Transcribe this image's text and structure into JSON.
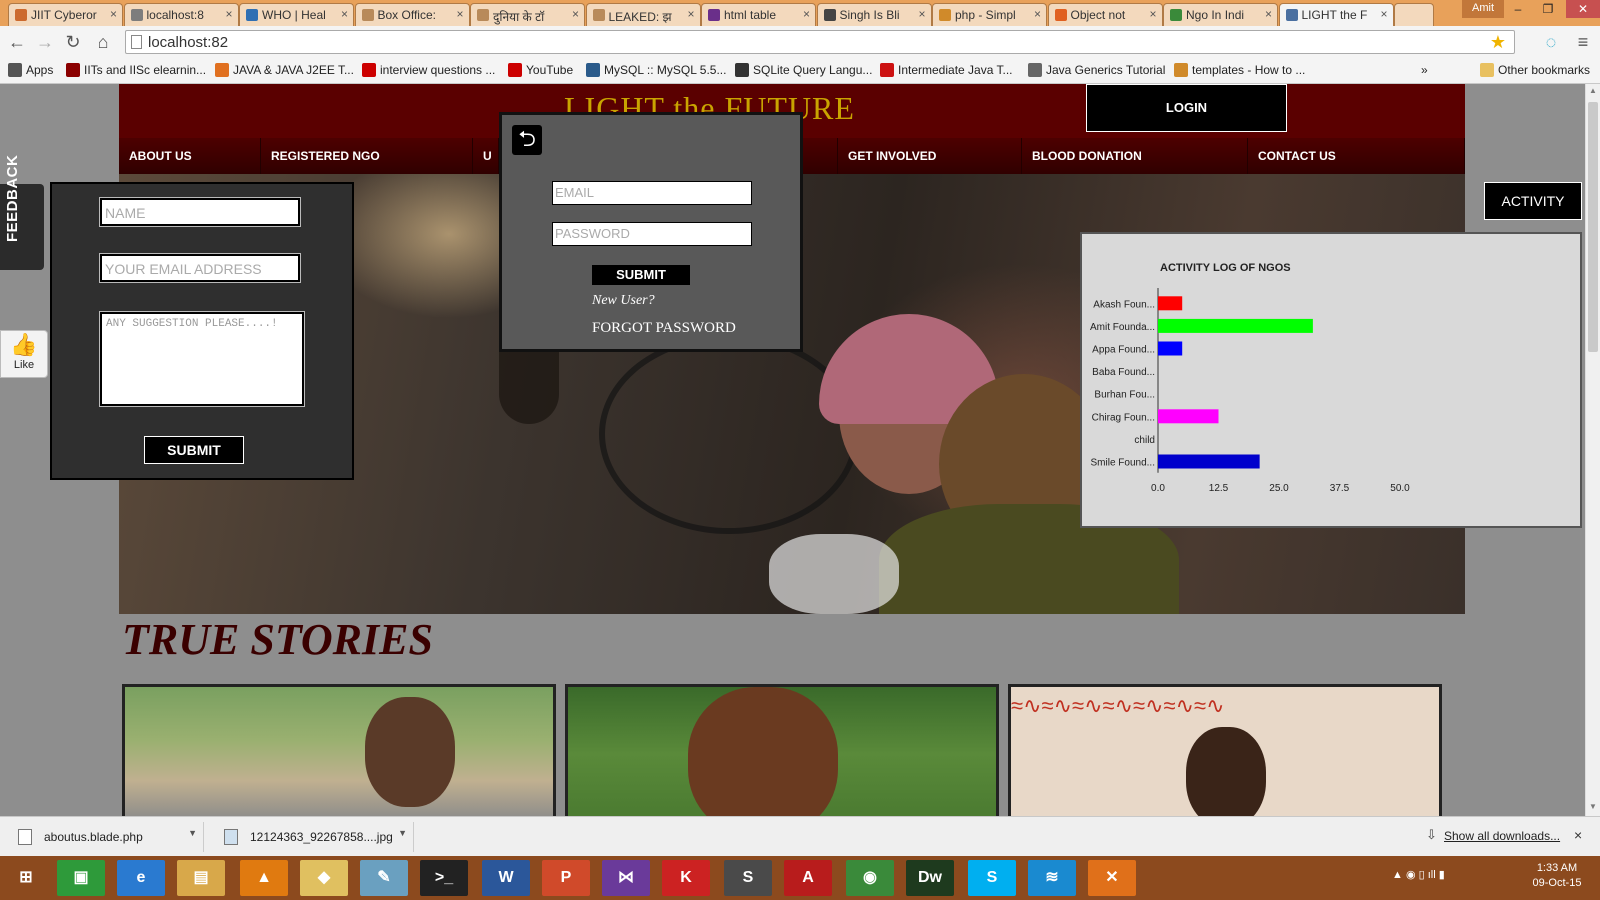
{
  "browser": {
    "tabs": [
      {
        "label": "JIIT Cyberor",
        "color": "#cc6a2e"
      },
      {
        "label": "localhost:8",
        "color": "#7d7d7d"
      },
      {
        "label": "WHO | Heal",
        "color": "#2f6fb3"
      },
      {
        "label": "Box Office:",
        "color": "#b88a5a"
      },
      {
        "label": "दुनिया के टॉ",
        "color": "#b88a5a"
      },
      {
        "label": "LEAKED: झ",
        "color": "#b88a5a"
      },
      {
        "label": "html table",
        "color": "#6a2f8a"
      },
      {
        "label": "Singh Is Bli",
        "color": "#444444"
      },
      {
        "label": "php - Simpl",
        "color": "#d08a2a"
      },
      {
        "label": "Object not",
        "color": "#e06020"
      },
      {
        "label": "Ngo In Indi",
        "color": "#3a8a3a"
      },
      {
        "label": "LIGHT the F",
        "color": "#4a6fa0"
      }
    ],
    "profile": "Amit",
    "address": "localhost:82",
    "bookmarks": [
      {
        "label": "Apps",
        "color": "#555555"
      },
      {
        "label": "IITs and IISc elearnin...",
        "color": "#8b0000"
      },
      {
        "label": "JAVA & JAVA J2EE T...",
        "color": "#e07020"
      },
      {
        "label": "interview questions ...",
        "color": "#cc0000"
      },
      {
        "label": "YouTube",
        "color": "#cc0000"
      },
      {
        "label": "MySQL :: MySQL 5.5...",
        "color": "#2a5a8a"
      },
      {
        "label": "SQLite Query Langu...",
        "color": "#333333"
      },
      {
        "label": "Intermediate Java T...",
        "color": "#cc1111"
      },
      {
        "label": "Java Generics Tutorial",
        "color": "#666666"
      },
      {
        "label": "templates - How to ...",
        "color": "#d08a2a"
      }
    ],
    "more_bookmarks": "»",
    "other_bookmarks": "Other bookmarks"
  },
  "site": {
    "title": "LIGHT the FUTURE",
    "login_button": "LOGIN",
    "nav": [
      "ABOUT US",
      "REGISTERED NGO",
      "U",
      "",
      "GET INVOLVED",
      "BLOOD DONATION",
      "CONTACT US"
    ],
    "stories_heading": "TRUE STORIES"
  },
  "feedback": {
    "tab_label": "FEEDBACK",
    "like_label": "Like",
    "name_placeholder": "NAME",
    "email_placeholder": "YOUR EMAIL ADDRESS",
    "suggestion_placeholder": "ANY SUGGESTION PLEASE....!",
    "submit_label": "SUBMIT"
  },
  "login_popup": {
    "email_placeholder": "EMAIL",
    "password_placeholder": "PASSWORD",
    "submit_label": "SUBMIT",
    "new_user": "New User?",
    "forgot_password": "FORGOT PASSWORD"
  },
  "activity": {
    "button_label": "ACTIVITY"
  },
  "chart_data": {
    "type": "bar",
    "orientation": "horizontal",
    "title": "ACTIVITY LOG OF NGOS",
    "categories": [
      "Akash Foun...",
      "Amit Founda...",
      "Appa Found...",
      "Baba Found...",
      "Burhan Fou...",
      "Chirag Foun...",
      "child",
      "Smile Found..."
    ],
    "values": [
      5,
      32,
      5,
      0,
      0,
      12.5,
      0,
      21
    ],
    "colors": [
      "#ff0000",
      "#00ff00",
      "#0000ff",
      "#ffff00",
      "#00ffff",
      "#ff00ff",
      "#808080",
      "#0000cc"
    ],
    "xticks": [
      "0.0",
      "12.5",
      "25.0",
      "37.5",
      "50.0"
    ],
    "xlim": [
      0,
      50
    ],
    "grid": false
  },
  "downloads": {
    "items": [
      "aboutus.blade.php",
      "12124363_92267858....jpg"
    ],
    "show_all": "Show all downloads...",
    "close": "×"
  },
  "taskbar": {
    "apps": [
      {
        "name": "start-icon",
        "glyph": "⊞",
        "color": "#8c4a1e"
      },
      {
        "name": "store-icon",
        "glyph": "▣",
        "color": "#2e9a3a"
      },
      {
        "name": "ie-icon",
        "glyph": "e",
        "color": "#2a7ad0"
      },
      {
        "name": "explorer-icon",
        "glyph": "▤",
        "color": "#d8a84a"
      },
      {
        "name": "vlc-icon",
        "glyph": "▲",
        "color": "#e07a10"
      },
      {
        "name": "photos-icon",
        "glyph": "◆",
        "color": "#e0c060"
      },
      {
        "name": "notes-icon",
        "glyph": "✎",
        "color": "#6aa0c0"
      },
      {
        "name": "cmd-icon",
        "glyph": ">_",
        "color": "#222222"
      },
      {
        "name": "word-icon",
        "glyph": "W",
        "color": "#2b579a"
      },
      {
        "name": "powerpoint-icon",
        "glyph": "P",
        "color": "#d04a2a"
      },
      {
        "name": "vs-icon",
        "glyph": "⋈",
        "color": "#6a3a9a"
      },
      {
        "name": "kaspersky-icon",
        "glyph": "K",
        "color": "#cc2222"
      },
      {
        "name": "sublime-icon",
        "glyph": "S",
        "color": "#4a4a4a"
      },
      {
        "name": "acrobat-icon",
        "glyph": "A",
        "color": "#b81c1c"
      },
      {
        "name": "chrome-icon",
        "glyph": "◉",
        "color": "#3a8a3a"
      },
      {
        "name": "dreamweaver-icon",
        "glyph": "Dw",
        "color": "#1e3a1e"
      },
      {
        "name": "skype-icon",
        "glyph": "S",
        "color": "#00aff0"
      },
      {
        "name": "wifi-icon",
        "glyph": "≋",
        "color": "#1a8ad0"
      },
      {
        "name": "xampp-icon",
        "glyph": "✕",
        "color": "#e0701a"
      }
    ],
    "time": "1:33 AM",
    "date": "09-Oct-15"
  }
}
